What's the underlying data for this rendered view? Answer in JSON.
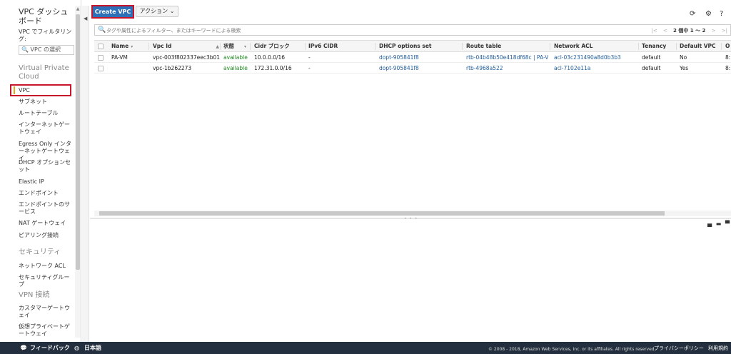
{
  "sidebar": {
    "dashboard_title": "VPC ダッシュボード",
    "filter_label": "VPC でフィルタリング:",
    "select_vpc": "VPC の選択",
    "sections": {
      "virtual_private_cloud": "Virtual Private Cloud",
      "security": "セキュリティ",
      "vpn": "VPN 接続"
    },
    "items": {
      "vpc": "VPC",
      "subnets": "サブネット",
      "route_tables": "ルートテーブル",
      "internet_gateways": "インターネットゲートウェイ",
      "egress_only": "Egress Only インターネットゲートウェイ",
      "dhcp_options": "DHCP オプションセット",
      "elastic_ip": "Elastic IP",
      "endpoints": "エンドポイント",
      "endpoint_services": "エンドポイントのサービス",
      "nat_gateways": "NAT ゲートウェイ",
      "peering": "ピアリング接続",
      "network_acl": "ネットワーク ACL",
      "security_groups": "セキュリティグループ",
      "customer_gateways": "カスタマーゲートウェイ",
      "virtual_private_gateways": "仮想プライベートゲートウェイ"
    }
  },
  "toolbar": {
    "create_vpc": "Create VPC",
    "actions": "アクション ⌄"
  },
  "icons": {
    "refresh": "⟳",
    "settings": "⚙",
    "help": "?",
    "search": "🔍"
  },
  "filter": {
    "placeholder": "タグや属性によるフィルター、またはキーワードによる検索",
    "pager_text": "2 個中 1 ～ 2"
  },
  "table": {
    "headers": {
      "name": "Name",
      "vpc_id": "Vpc Id",
      "state": "状態",
      "cidr": "Cidr ブロック",
      "ipv6": "IPv6 CIDR",
      "dhcp": "DHCP options set",
      "route": "Route table",
      "acl": "Network ACL",
      "tenancy": "Tenancy",
      "default_vpc": "Default VPC",
      "owner": "O"
    },
    "rows": [
      {
        "name": "PA-VM",
        "vpc_id": "vpc-003f802337eec3b01",
        "state": "available",
        "cidr": "10.0.0.0/16",
        "ipv6": "-",
        "dhcp": "dopt-905841f8",
        "route": "rtb-04b48b50e418df68c | PA-V...",
        "acl": "acl-03c231490a8d0b3b3",
        "tenancy": "default",
        "default_vpc": "No",
        "owner": "8:"
      },
      {
        "name": "",
        "vpc_id": "vpc-1b262273",
        "state": "available",
        "cidr": "172.31.0.0/16",
        "ipv6": "-",
        "dhcp": "dopt-905841f8",
        "route": "rtb-4968a522",
        "acl": "acl-7102e11a",
        "tenancy": "default",
        "default_vpc": "Yes",
        "owner": "8:"
      }
    ]
  },
  "footer": {
    "feedback": "フィードバック",
    "language": "日本語",
    "copyright": "© 2008 - 2018, Amazon Web Services, Inc. or its affiliates. All rights reserved.",
    "privacy": "プライバシーポリシー",
    "terms": "利用規約"
  }
}
